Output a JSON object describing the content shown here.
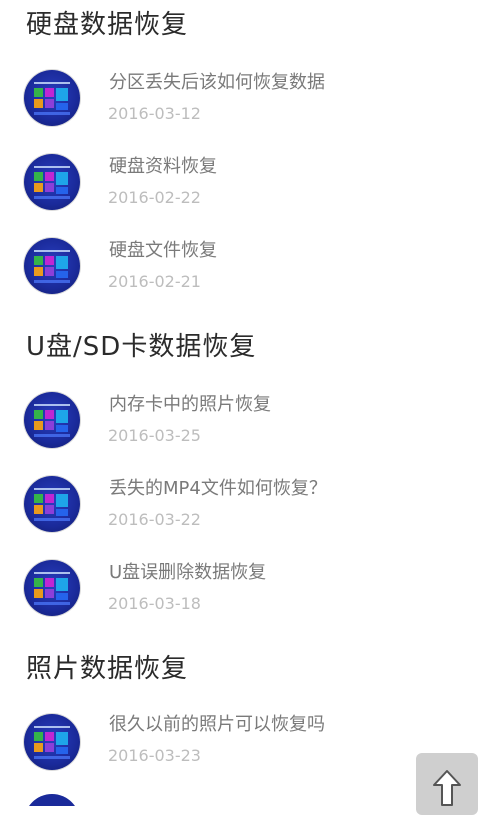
{
  "sections": [
    {
      "title": "硬盘数据恢复",
      "items": [
        {
          "title": "分区丢失后该如何恢复数据",
          "date": "2016-03-12"
        },
        {
          "title": "硬盘资料恢复",
          "date": "2016-02-22"
        },
        {
          "title": "硬盘文件恢复",
          "date": "2016-02-21"
        }
      ]
    },
    {
      "title": "U盘/SD卡数据恢复",
      "items": [
        {
          "title": "内存卡中的照片恢复",
          "date": "2016-03-25"
        },
        {
          "title": "丢失的MP4文件如何恢复？",
          "date": "2016-03-22"
        },
        {
          "title": "U盘误删除数据恢复",
          "date": "2016-03-18"
        }
      ]
    },
    {
      "title": "照片数据恢复",
      "items": [
        {
          "title": "很久以前的照片可以恢复吗",
          "date": "2016-03-23"
        }
      ]
    }
  ],
  "icons": {
    "scroll_top": "arrow-up-icon"
  }
}
